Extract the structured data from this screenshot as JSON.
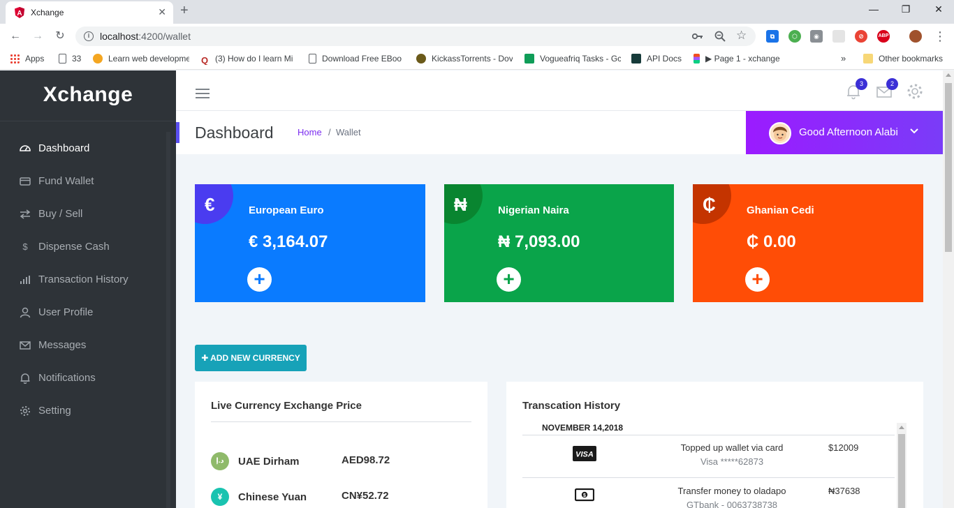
{
  "browser": {
    "tab_title": "Xchange",
    "url_host": "localhost",
    "url_rest": ":4200/wallet",
    "bookmarks": [
      {
        "label": "Apps",
        "color": "#e8453c"
      },
      {
        "label": "33",
        "color": "#ffffff"
      },
      {
        "label": "Learn web developme",
        "color": "#f4a621"
      },
      {
        "label": "(3) How do I learn Mi",
        "color": "#b92b27"
      },
      {
        "label": "Download Free EBoo",
        "color": "#ffffff"
      },
      {
        "label": "KickassTorrents - Dov",
        "color": "#6b5a1a"
      },
      {
        "label": "Vogueafriq Tasks - Gc",
        "color": "#0f9d58"
      },
      {
        "label": "API Docs",
        "color": "#173b3a"
      },
      {
        "label": "Page 1 - xchange",
        "color": "#a259ff"
      }
    ],
    "bookmarks_overflow": "»",
    "other_bookmarks": "Other bookmarks"
  },
  "app": {
    "brand": "Xchange",
    "nav": [
      {
        "label": "Dashboard",
        "icon": "dashboard-icon",
        "active": true
      },
      {
        "label": "Fund Wallet",
        "icon": "card-icon",
        "active": false
      },
      {
        "label": "Buy / Sell",
        "icon": "exchange-icon",
        "active": false
      },
      {
        "label": "Dispense Cash",
        "icon": "dollar-icon",
        "active": false
      },
      {
        "label": "Transaction History",
        "icon": "bar-chart-icon",
        "active": false
      },
      {
        "label": "User Profile",
        "icon": "user-icon",
        "active": false
      },
      {
        "label": "Messages",
        "icon": "envelope-icon",
        "active": false
      },
      {
        "label": "Notifications",
        "icon": "bell-icon",
        "active": false
      },
      {
        "label": "Setting",
        "icon": "gear-icon",
        "active": false
      }
    ],
    "notifications_count": "3",
    "messages_count": "2"
  },
  "header": {
    "title": "Dashboard",
    "breadcrumb_home": "Home",
    "breadcrumb_sep": "/",
    "breadcrumb_current": "Wallet",
    "greeting": "Good Afternoon Alabi"
  },
  "wallets": [
    {
      "symbol": "€",
      "name": "European Euro",
      "amount": "€ 3,164.07",
      "color": "#0a7bff",
      "circle": "#4a3cf0"
    },
    {
      "symbol": "₦",
      "name": "Nigerian Naira",
      "amount": "₦ 7,093.00",
      "color": "#0aa44a",
      "circle": "#098530"
    },
    {
      "symbol": "₵",
      "name": "Ghanian Cedi",
      "amount": "₵ 0.00",
      "color": "#ff4d06",
      "circle": "#c43400"
    }
  ],
  "add_currency_label": "ADD NEW CURRENCY",
  "live_prices": {
    "title": "Live Currency Exchange Price",
    "rates": [
      {
        "name": "UAE Dirham",
        "value": "AED98.72",
        "icon_text": "د.إ",
        "color": "#8fba6a"
      },
      {
        "name": "Chinese Yuan",
        "value": "CN¥52.72",
        "icon_text": "¥",
        "color": "#19c3b0"
      }
    ]
  },
  "transactions": {
    "title": "Transcation History",
    "date": "NOVEMBER 14,2018",
    "items": [
      {
        "icon": "visa-icon",
        "icon_text": "VISA",
        "desc": "Topped up wallet via card",
        "sub": "Visa *****62873",
        "amount": "$12009"
      },
      {
        "icon": "cash-icon",
        "icon_text": "",
        "desc": "Transfer money to oladapo",
        "sub": "GTbank - 0063738738",
        "amount": "₦37638"
      }
    ]
  }
}
